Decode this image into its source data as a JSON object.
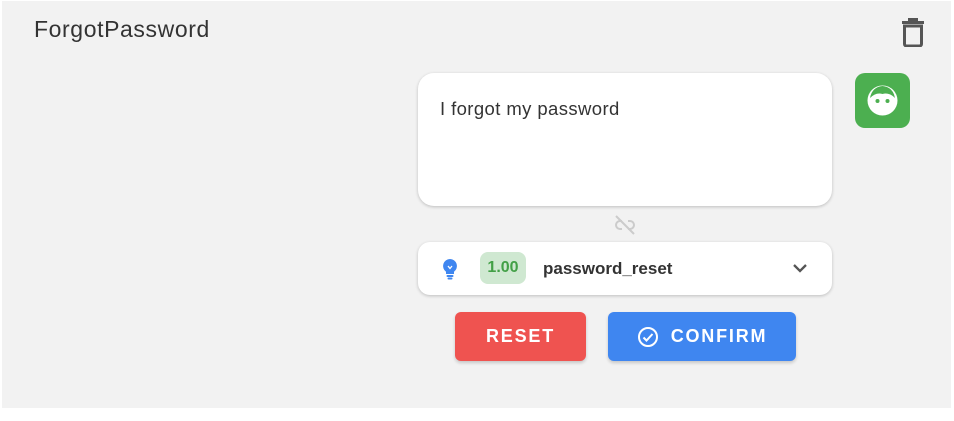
{
  "header": {
    "title": "ForgotPassword",
    "delete_icon": "trash-icon"
  },
  "message": {
    "text": "I forgot my password",
    "avatar_icon": "user-face-icon",
    "avatar_color": "#4caf50"
  },
  "link_status_icon": "unlink-icon",
  "intent": {
    "icon": "lightbulb-icon",
    "confidence": "1.00",
    "name": "password_reset",
    "expand_icon": "chevron-down-icon"
  },
  "actions": {
    "reset_label": "RESET",
    "confirm_label": "CONFIRM",
    "confirm_icon": "check-circle-icon"
  },
  "colors": {
    "reset": "#ef5350",
    "confirm": "#3f86f0",
    "badge_bg": "#cfe8d1",
    "badge_text": "#43a047",
    "panel_bg": "#f2f2f2"
  }
}
